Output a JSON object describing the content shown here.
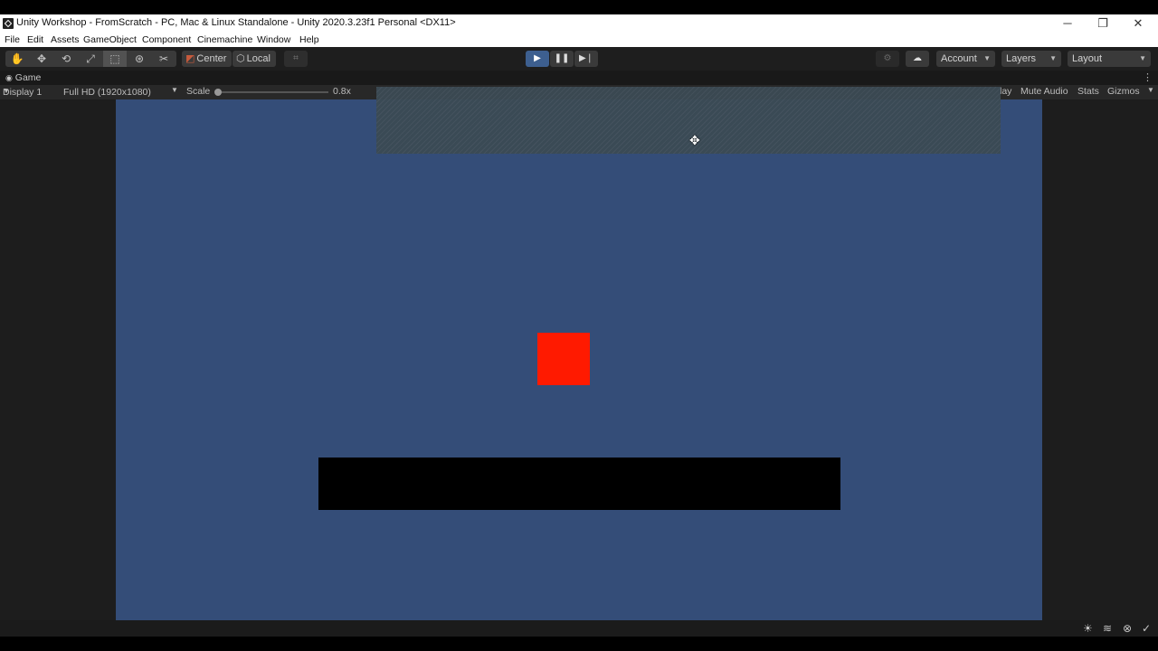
{
  "window": {
    "title": "Unity Workshop - FromScratch - PC, Mac & Linux Standalone - Unity 2020.3.23f1 Personal <DX11>",
    "controls": {
      "minimize": "─",
      "restore": "❐",
      "close": "✕"
    }
  },
  "menu": [
    "File",
    "Edit",
    "Assets",
    "GameObject",
    "Component",
    "Cinemachine",
    "Window",
    "Help"
  ],
  "toolbar": {
    "tools": [
      "✋",
      "✥",
      "⟲",
      "⤢",
      "⬚",
      "⊛",
      "✂"
    ],
    "pivot_center": "Center",
    "pivot_local": "Local",
    "grid_icon": "⌗",
    "play": "▶",
    "pause": "❚❚",
    "step": "▶❘",
    "collab_icon": "⚙",
    "cloud_icon": "☁",
    "account": "Account",
    "layers": "Layers",
    "layout": "Layout",
    "caret": "▼"
  },
  "game_tab": {
    "label": "Game",
    "icon": "◉",
    "menu": "⋮"
  },
  "game_bar": {
    "display": "Display 1",
    "resolution": "Full HD (1920x1080)",
    "scale_label": "Scale",
    "scale_value": "0.8x",
    "scale_level": 0.0,
    "maximize_partial": "lay",
    "mute_audio": "Mute Audio",
    "stats": "Stats",
    "gizmos": "Gizmos"
  },
  "status_icons": [
    "☀",
    "≋",
    "⊗",
    "✓"
  ],
  "colors": {
    "game_background": "#344d78",
    "player": "#ff1a00",
    "platform": "#000000",
    "play_active": "#3d5f8f"
  }
}
